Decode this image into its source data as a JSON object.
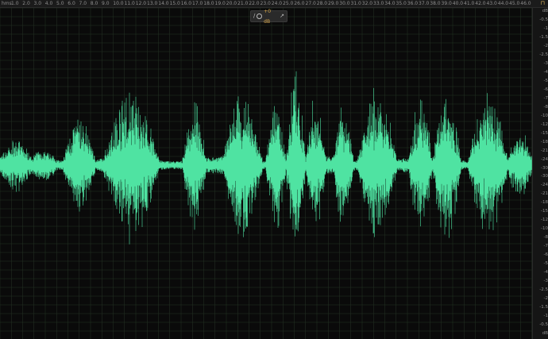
{
  "ruler": {
    "unit_label": "hms",
    "ticks": [
      "1.0",
      "2.0",
      "3.0",
      "4.0",
      "5.0",
      "6.0",
      "7.0",
      "8.0",
      "9.0",
      "10.0",
      "11.0",
      "12.0",
      "13.0",
      "14.0",
      "15.0",
      "16.0",
      "17.0",
      "18.0",
      "19.0",
      "20.0",
      "21.0",
      "22.0",
      "23.0",
      "24.0",
      "25.0",
      "26.0",
      "27.0",
      "28.0",
      "29.0",
      "30.0",
      "31.0",
      "32.0",
      "33.0",
      "34.0",
      "35.0",
      "36.0",
      "37.0",
      "38.0",
      "39.0",
      "40.0",
      "41.0",
      "42.0",
      "43.0",
      "44.0",
      "45.0",
      "46.0"
    ]
  },
  "hud": {
    "gain_value": "+0 dB",
    "left_icon": "amplitude-icon",
    "right_icon": "wand-icon"
  },
  "amplitude_scale": {
    "labels": [
      "dB",
      "-0.5",
      "-1",
      "-1.5",
      "-2",
      "-2.5",
      "-3",
      "-4",
      "-5",
      "-6",
      "-7",
      "-8",
      "-10",
      "-12",
      "-15",
      "-18",
      "-21",
      "-24",
      "-30",
      "-30",
      "-24",
      "-21",
      "-18",
      "-15",
      "-12",
      "-10",
      "-8",
      "-7",
      "-6",
      "-5",
      "-4",
      "-3",
      "-2.5",
      "-2",
      "-1.5",
      "-1",
      "-0.5",
      "dB"
    ]
  },
  "corner_icon": "playhead-icon",
  "colors": {
    "waveform": "#4fe3a2",
    "background": "#0a0a0a",
    "grid": "#2a3a2a"
  }
}
